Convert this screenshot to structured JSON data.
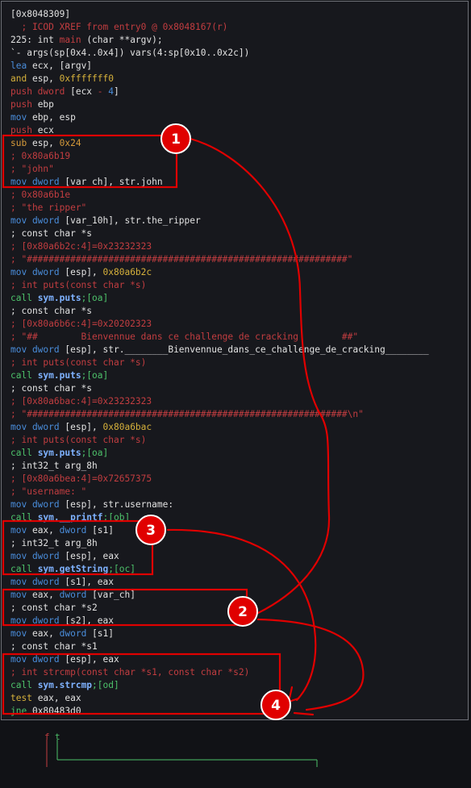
{
  "lines": [
    [
      [
        "w",
        "[0x8048309]"
      ]
    ],
    [
      [
        "c",
        "  ; ICOD XREF from entry0 @ 0x8048167(r)"
      ]
    ],
    [
      [
        "w",
        "225: int "
      ],
      [
        "c",
        "main"
      ],
      [
        "w",
        " (char **argv);"
      ]
    ],
    [
      [
        "w",
        "`- args(sp[0x4..0x4]) vars(4:sp[0x10..0x2c])"
      ]
    ],
    [
      [
        "b",
        "lea "
      ],
      [
        "w",
        "ecx, [argv]"
      ]
    ],
    [
      [
        "y",
        "and "
      ],
      [
        "w",
        "esp, "
      ],
      [
        "y",
        "0xfffffff0"
      ]
    ],
    [
      [
        "c",
        "push dword "
      ],
      [
        "w",
        "[ecx "
      ],
      [
        "c",
        "- "
      ],
      [
        "b",
        "4"
      ],
      [
        "w",
        "]"
      ]
    ],
    [
      [
        "c",
        "push "
      ],
      [
        "w",
        "ebp"
      ]
    ],
    [
      [
        "b",
        "mov "
      ],
      [
        "w",
        "ebp, esp"
      ]
    ],
    [
      [
        "c",
        "push "
      ],
      [
        "w",
        "ecx"
      ]
    ],
    [
      [
        "o",
        "sub "
      ],
      [
        "w",
        "esp, "
      ],
      [
        "o",
        "0x24"
      ]
    ],
    [
      [
        "c",
        "; 0x80a6b19"
      ]
    ],
    [
      [
        "c",
        "; \"john\""
      ]
    ],
    [
      [
        "b",
        "mov dword "
      ],
      [
        "w",
        "[var_ch], str.john"
      ]
    ],
    [
      [
        "c",
        "; 0x80a6b1e"
      ]
    ],
    [
      [
        "c",
        "; \"the ripper\""
      ]
    ],
    [
      [
        "b",
        "mov dword "
      ],
      [
        "w",
        "[var_10h], str.the_ripper"
      ]
    ],
    [
      [
        "w",
        "; const char *s"
      ]
    ],
    [
      [
        "c",
        "; [0x80a6b2c:4]=0x23232323"
      ]
    ],
    [
      [
        "c",
        "; \"###########################################################\""
      ]
    ],
    [
      [
        "b",
        "mov dword "
      ],
      [
        "w",
        "[esp], "
      ],
      [
        "y",
        "0x80a6b2c"
      ]
    ],
    [
      [
        "c",
        "; int puts(const char *s)"
      ]
    ],
    [
      [
        "g",
        "call "
      ],
      [
        "sym",
        "sym.puts"
      ],
      [
        "g",
        ";[oa]"
      ]
    ],
    [
      [
        "w",
        "; const char *s"
      ]
    ],
    [
      [
        "c",
        "; [0x80a6b6c:4]=0x20202323"
      ]
    ],
    [
      [
        "c",
        "; \"##        Bienvennue dans ce challenge de cracking        ##\""
      ]
    ],
    [
      [
        "b",
        "mov dword "
      ],
      [
        "w",
        "[esp], str.________Bienvennue_dans_ce_challenge_de_cracking________"
      ]
    ],
    [
      [
        "c",
        "; int puts(const char *s)"
      ]
    ],
    [
      [
        "g",
        "call "
      ],
      [
        "sym",
        "sym.puts"
      ],
      [
        "g",
        ";[oa]"
      ]
    ],
    [
      [
        "w",
        "; const char *s"
      ]
    ],
    [
      [
        "c",
        "; [0x80a6bac:4]=0x23232323"
      ]
    ],
    [
      [
        "c",
        "; \"###########################################################\\n\""
      ]
    ],
    [
      [
        "b",
        "mov dword "
      ],
      [
        "w",
        "[esp], "
      ],
      [
        "y",
        "0x80a6bac"
      ]
    ],
    [
      [
        "c",
        "; int puts(const char *s)"
      ]
    ],
    [
      [
        "g",
        "call "
      ],
      [
        "sym",
        "sym.puts"
      ],
      [
        "g",
        ";[oa]"
      ]
    ],
    [
      [
        "w",
        "; int32_t arg_8h"
      ]
    ],
    [
      [
        "c",
        "; [0x80a6bea:4]=0x72657375"
      ]
    ],
    [
      [
        "c",
        "; \"username: \""
      ]
    ],
    [
      [
        "b",
        "mov dword "
      ],
      [
        "w",
        "[esp], str.username:"
      ]
    ],
    [
      [
        "g",
        "call "
      ],
      [
        "sym",
        "sym.__printf"
      ],
      [
        "g",
        ";[ob]"
      ]
    ],
    [
      [
        "b",
        "mov "
      ],
      [
        "w",
        "eax, "
      ],
      [
        "b",
        "dword "
      ],
      [
        "w",
        "[s1]"
      ]
    ],
    [
      [
        "w",
        "; int32_t arg_8h"
      ]
    ],
    [
      [
        "b",
        "mov dword "
      ],
      [
        "w",
        "[esp], eax"
      ]
    ],
    [
      [
        "g",
        "call "
      ],
      [
        "sym",
        "sym.getString"
      ],
      [
        "g",
        ";[oc]"
      ]
    ],
    [
      [
        "b",
        "mov dword "
      ],
      [
        "w",
        "[s1], eax"
      ]
    ],
    [
      [
        "b",
        "mov "
      ],
      [
        "w",
        "eax, "
      ],
      [
        "b",
        "dword "
      ],
      [
        "w",
        "[var_ch]"
      ]
    ],
    [
      [
        "w",
        "; const char *s2"
      ]
    ],
    [
      [
        "b",
        "mov dword "
      ],
      [
        "w",
        "[s2], eax"
      ]
    ],
    [
      [
        "b",
        "mov "
      ],
      [
        "w",
        "eax, "
      ],
      [
        "b",
        "dword "
      ],
      [
        "w",
        "[s1]"
      ]
    ],
    [
      [
        "w",
        "; const char *s1"
      ]
    ],
    [
      [
        "b",
        "mov dword "
      ],
      [
        "w",
        "[esp], eax"
      ]
    ],
    [
      [
        "c",
        "; int strcmp(const char *s1, const char *s2)"
      ]
    ],
    [
      [
        "g",
        "call "
      ],
      [
        "sym",
        "sym.strcmp"
      ],
      [
        "g",
        ";[od]"
      ]
    ],
    [
      [
        "y",
        "test "
      ],
      [
        "w",
        "eax, eax"
      ]
    ],
    [
      [
        "g",
        "jne "
      ],
      [
        "w",
        "0x80483d0"
      ]
    ]
  ],
  "branch": {
    "false_label": "f",
    "true_label": "t"
  },
  "annotations": [
    "1",
    "2",
    "3",
    "4"
  ],
  "colors": {
    "background": "#17181d",
    "annotation_red": "#e00000",
    "comment": "#c23d40",
    "keyword_blue": "#4a8ddb",
    "call_green": "#4dc16a",
    "number_yellow": "#d6b13b"
  }
}
